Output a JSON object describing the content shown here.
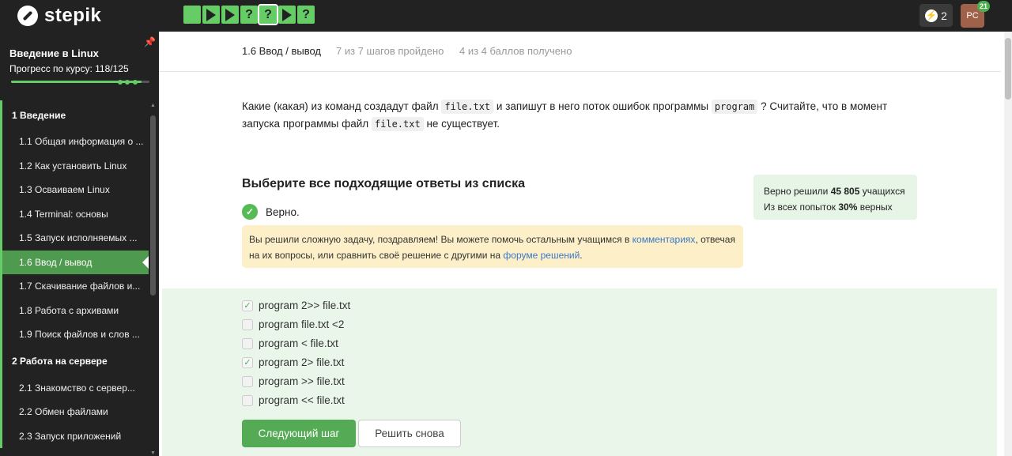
{
  "topbar": {
    "logo_text": "stepik",
    "steps": [
      {
        "kind": "text"
      },
      {
        "kind": "play"
      },
      {
        "kind": "play"
      },
      {
        "kind": "quiz",
        "label": "?"
      },
      {
        "kind": "quiz",
        "label": "?",
        "active": true
      },
      {
        "kind": "play"
      },
      {
        "kind": "quiz",
        "label": "?"
      }
    ],
    "energy_count": "2",
    "avatar_initials": "PC",
    "notifications_count": "21"
  },
  "sidebar": {
    "course_title": "Введение в Linux",
    "progress_label": "Прогресс по курсу:",
    "progress_value": "118/125",
    "progress_fraction": 0.944,
    "module1": {
      "label": "1  Введение"
    },
    "items": [
      {
        "label": "1.1  Общая информация о ..."
      },
      {
        "label": "1.2  Как установить Linux"
      },
      {
        "label": "1.3  Осваиваем Linux"
      },
      {
        "label": "1.4  Terminal: основы"
      },
      {
        "label": "1.5  Запуск исполняемых ..."
      },
      {
        "label": "1.6  Ввод / вывод",
        "active": true
      },
      {
        "label": "1.7  Скачивание файлов и..."
      },
      {
        "label": "1.8  Работа с архивами"
      },
      {
        "label": "1.9  Поиск файлов и слов ..."
      }
    ],
    "module2": {
      "label": "2  Работа на сервере"
    },
    "items2": [
      {
        "label": "2.1  Знакомство с сервер..."
      },
      {
        "label": "2.2  Обмен файлами"
      },
      {
        "label": "2.3  Запуск приложений"
      }
    ]
  },
  "header": {
    "lesson": "1.6 Ввод / вывод",
    "steps_done": "7 из 7 шагов пройдено",
    "score": "4 из 4 баллов  получено"
  },
  "question": {
    "part1": "Какие (какая) из команд создадут файл ",
    "code1": "file.txt",
    "part2": " и запишут в него поток ошибок программы ",
    "code2": "program",
    "part3": " ? Считайте, что в момент запуска программы файл ",
    "code3": "file.txt",
    "part4": " не существует."
  },
  "choose_title": "Выберите все подходящие ответы из списка",
  "verdict": "Верно.",
  "congrats": {
    "text1": "Вы решили сложную задачу, поздравляем! Вы можете помочь остальным учащимся в ",
    "link1": "комментариях",
    "text2": ", отвечая на их вопросы, или сравнить своё решение с другими на ",
    "link2": "форуме решений",
    "text3": "."
  },
  "stats": {
    "line1_prefix": "Верно решили ",
    "line1_count": "45 805",
    "line1_suffix": " учащихся",
    "line2_prefix": "Из всех попыток ",
    "line2_pct": "30%",
    "line2_suffix": " верных"
  },
  "options": [
    {
      "label": "program 2>> file.txt",
      "checked": true
    },
    {
      "label": "program file.txt <2",
      "checked": false
    },
    {
      "label": "program < file.txt",
      "checked": false
    },
    {
      "label": "program 2> file.txt",
      "checked": true
    },
    {
      "label": "program >> file.txt",
      "checked": false
    },
    {
      "label": "program << file.txt",
      "checked": false
    }
  ],
  "buttons": {
    "next": "Следующий шаг",
    "retry": "Решить снова"
  },
  "colors": {
    "accent_green": "#66cc66",
    "topbar_bg": "#222222",
    "answers_bg": "#e9f6e9",
    "notice_bg": "#fdf0c8",
    "link": "#3a78c8"
  }
}
